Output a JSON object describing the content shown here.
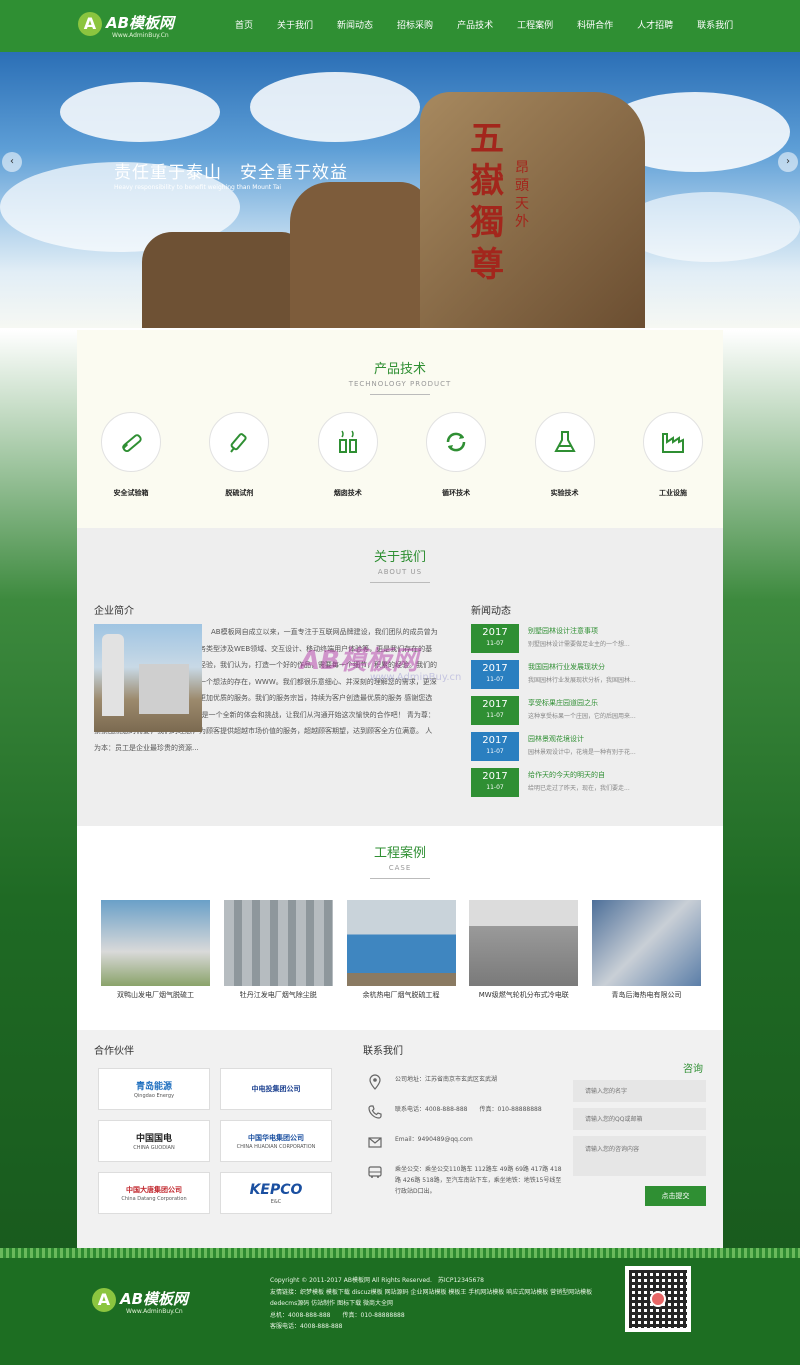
{
  "header": {
    "logo_mark": "A",
    "logo_text": "AB模板网",
    "logo_sub": "Www.AdminBuy.Cn",
    "nav": [
      "首页",
      "关于我们",
      "新闻动态",
      "招标采购",
      "产品技术",
      "工程案例",
      "科研合作",
      "人才招聘",
      "联系我们"
    ]
  },
  "banner": {
    "title": "责任重于泰山　安全重于效益",
    "subtitle": "Heavy responsibility to benefit weighing than Mount Tai",
    "prev": "‹",
    "next": "›"
  },
  "products": {
    "title": "产品技术",
    "subtitle": "TECHNOLOGY PRODUCT",
    "items": [
      {
        "label": "安全试验箱",
        "icon": "test-tube-icon"
      },
      {
        "label": "脱硫试剂",
        "icon": "syringe-icon"
      },
      {
        "label": "烟囱技术",
        "icon": "chimney-icon"
      },
      {
        "label": "循环技术",
        "icon": "cycle-icon"
      },
      {
        "label": "实验技术",
        "icon": "flask-icon"
      },
      {
        "label": "工业设施",
        "icon": "factory-icon"
      }
    ]
  },
  "about": {
    "title": "关于我们",
    "subtitle": "ABOUT US",
    "intro_title": "企业简介",
    "intro_text": "AB模板网自成立以来，一直专注于互联网品牌建设，我们团队的成员曾为国内优秀广告公司及互联网公司业务类型涉及WEB领域、交互设计、移动终端用户体验等，更是我们存在的基石。我们注重每一个细节，积累的经验，我们认为，打造一个好的作品，需要每一个细节，积累的经验。我们的服务不会因为我们的疏忽而丢失某一个想法的存在，WWW。我们都很乐意细心、并深刻的理解您的需求，更深入的了解您的企业，以便为您提供更加优质的服务。我们的服务宗旨，持续为客户创造最优质的服务 感谢您选择AB模板网，每一次用心的合作都是一个全新的体会和挑战，让我们从沟通开始这次愉快的合作吧！ 青为尊：紧紧围绕您的需要，我们的理念，为顾客提供超越市场价值的服务，超越顾客期望，达到顾客全方位满意。 人为本：员工是企业最珍贵的资源...",
    "news_title": "新闻动态",
    "news": [
      {
        "year": "2017",
        "day": "11-07",
        "headline": "别墅园林设计注意事项",
        "desc": "别墅园林设计需要做足业主的一个想...",
        "color": "#2f8f33"
      },
      {
        "year": "2017",
        "day": "11-07",
        "headline": "我国园林行业发展现状分",
        "desc": "我国园林行业发展现状分析，我国园林...",
        "color": "#2a7fc0"
      },
      {
        "year": "2017",
        "day": "11-07",
        "headline": "享受标果庄园道园之乐",
        "desc": "这种享受标果一个庄园，它的后园用来...",
        "color": "#2f8f33"
      },
      {
        "year": "2017",
        "day": "11-07",
        "headline": "园林景观花境设计",
        "desc": "园林景观设计中，花境是一种有别于花...",
        "color": "#2a7fc0"
      },
      {
        "year": "2017",
        "day": "11-07",
        "headline": "给作天的今天的明天的自",
        "desc": "给明已走过了昨天，现在，我们要走...",
        "color": "#2f8f33"
      }
    ]
  },
  "cases": {
    "title": "工程案例",
    "subtitle": "CASE",
    "items": [
      {
        "label": "双鸭山发电厂烟气脱硫工",
        "color": "#6aa0c8"
      },
      {
        "label": "牡丹江发电厂烟气除尘脱",
        "color": "#9aa6ad"
      },
      {
        "label": "余杭热电厂烟气脱硫工程",
        "color": "#4b8fc2"
      },
      {
        "label": "MW级燃气轮机分布式冷电联",
        "color": "#b8b8b8"
      },
      {
        "label": "青岛后海热电有限公司",
        "color": "#5b7ea8"
      }
    ]
  },
  "partners": {
    "title": "合作伙伴",
    "items": [
      {
        "name": "青岛能源",
        "sub": "Qingdao Energy",
        "color": "#1f6fbf"
      },
      {
        "name": "中电投集团公司",
        "sub": "",
        "color": "#1a3f8f"
      },
      {
        "name": "中国国电",
        "sub": "CHINA GUODIAN",
        "color": "#222222"
      },
      {
        "name": "中国华电集团公司",
        "sub": "CHINA HUADIAN CORPORATION",
        "color": "#1a4fa0"
      },
      {
        "name": "中国大唐集团公司",
        "sub": "China Datang Corporation",
        "color": "#c0262c"
      },
      {
        "name": "KEPCO",
        "sub": "E&C",
        "color": "#1a4fa0"
      }
    ]
  },
  "contact": {
    "title": "联系我们",
    "address": "公司地址：江苏省南京市玄武区玄武湖",
    "phone": "联系电话：4008-888-888　　传真：010-88888888",
    "email": "Email：9490489@qq.com",
    "bus": "乘坐公交：乘坐公交110路车 112路车 49路 69路 417路 418路 426路 518路，至汽车南站下车，乘坐地铁：地铁15号线至行政站D口出。"
  },
  "inquiry": {
    "title": "咨询",
    "name_placeholder": "请输入您的名字",
    "qq_placeholder": "请输入您的QQ或邮箱",
    "message_placeholder": "请输入您的咨询内容",
    "submit": "点击提交"
  },
  "footer": {
    "logo_text": "AB模板网",
    "logo_sub": "Www.AdminBuy.Cn",
    "copyright": "Copyright © 2011-2017 AB模板网 All Rights Reserved.　苏ICP12345678",
    "links": "友情链接：织梦模板 模板下载 discuz模板 网站源码 企业网站模板 模板王 手机网站模板 响应式网站模板 营销型网站模板 dedecms源码 仿站制作 图标下载 微商大全网",
    "phone": "总机：4008-888-888　　传真：010-88888888",
    "service": "客服电话：4008-888-888"
  },
  "watermark": {
    "text": "AB模板网",
    "sub": "www.AdminBuy.cn"
  }
}
